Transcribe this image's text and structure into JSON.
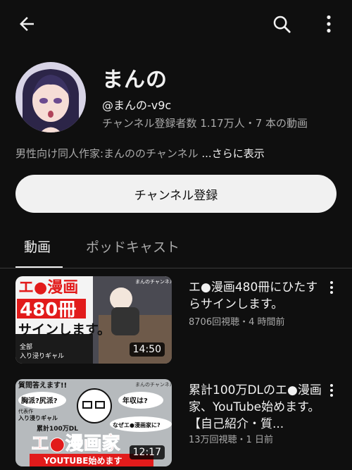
{
  "channel": {
    "name": "まんの",
    "handle": "@まんの-v9c",
    "stats": "チャンネル登録者数 1.17万人・7 本の動画",
    "description": "男性向け同人作家:まんののチャンネル",
    "more_label": "...さらに表示",
    "subscribe_label": "チャンネル登録"
  },
  "tabs": [
    {
      "label": "動画",
      "active": true
    },
    {
      "label": "ポッドキャスト",
      "active": false
    }
  ],
  "videos": [
    {
      "title": "エ●漫画480冊にひたすらサインします。",
      "meta": "8706回視聴・4 時間前",
      "duration": "14:50",
      "thumb_text": {
        "line1": "エ●漫画",
        "line2": "480冊",
        "line3": "サインします。",
        "sub1": "全部",
        "sub2": "入り浸りギャル",
        "tag": "まんのチャンネル"
      }
    },
    {
      "title": "累計100万DLのエ●漫画家、YouTube始めます。【自己紹介・質...",
      "meta": "13万回視聴・1 日前",
      "duration": "12:17",
      "thumb_text": {
        "head": "質問答えます!!",
        "b1": "胸派?尻派?",
        "b2": "年収は?",
        "b3": "なぜエ●漫画家に?",
        "small1": "代表作",
        "small2": "入り浸りギャル",
        "small3": "累計100万DL",
        "big": "エ●漫画家",
        "bottom": "YOUTUBE始めます",
        "tag": "まんのチャンネル"
      }
    }
  ],
  "colors": {
    "background": "#0f0f0f",
    "text_primary": "#f1f1f1",
    "text_secondary": "#aaaaaa",
    "accent_red": "#e21b1b"
  },
  "icons": [
    "back-arrow-icon",
    "search-icon",
    "more-vert-icon"
  ]
}
